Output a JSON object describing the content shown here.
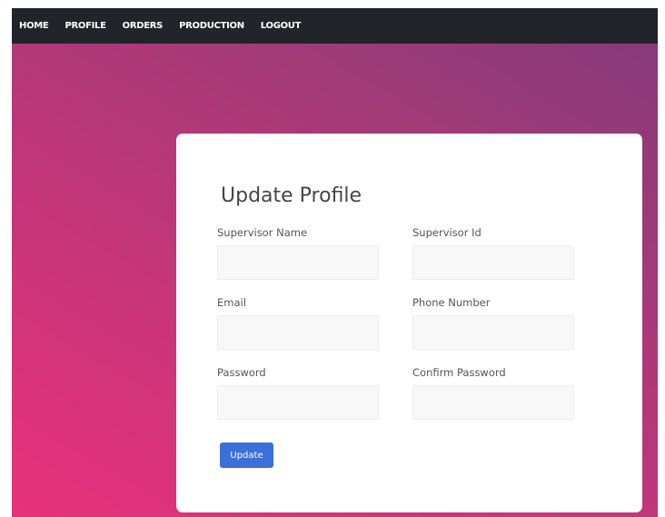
{
  "nav": {
    "items": [
      {
        "label": "HOME"
      },
      {
        "label": "PROFILE"
      },
      {
        "label": "ORDERS"
      },
      {
        "label": "PRODUCTION"
      },
      {
        "label": "LOGOUT"
      }
    ],
    "background_color": "#212529"
  },
  "form": {
    "title": "Update Profile",
    "fields": {
      "supervisor_name": {
        "label": "Supervisor Name",
        "value": ""
      },
      "supervisor_id": {
        "label": "Supervisor Id",
        "value": ""
      },
      "email": {
        "label": "Email",
        "value": ""
      },
      "phone_number": {
        "label": "Phone Number",
        "value": ""
      },
      "password": {
        "label": "Password",
        "value": ""
      },
      "confirm_password": {
        "label": "Confirm Password",
        "value": ""
      }
    },
    "submit_label": "Update",
    "submit_color": "#3c6fd8"
  },
  "theme": {
    "gradient_start": "#e8317a",
    "gradient_end": "#833a7a"
  }
}
